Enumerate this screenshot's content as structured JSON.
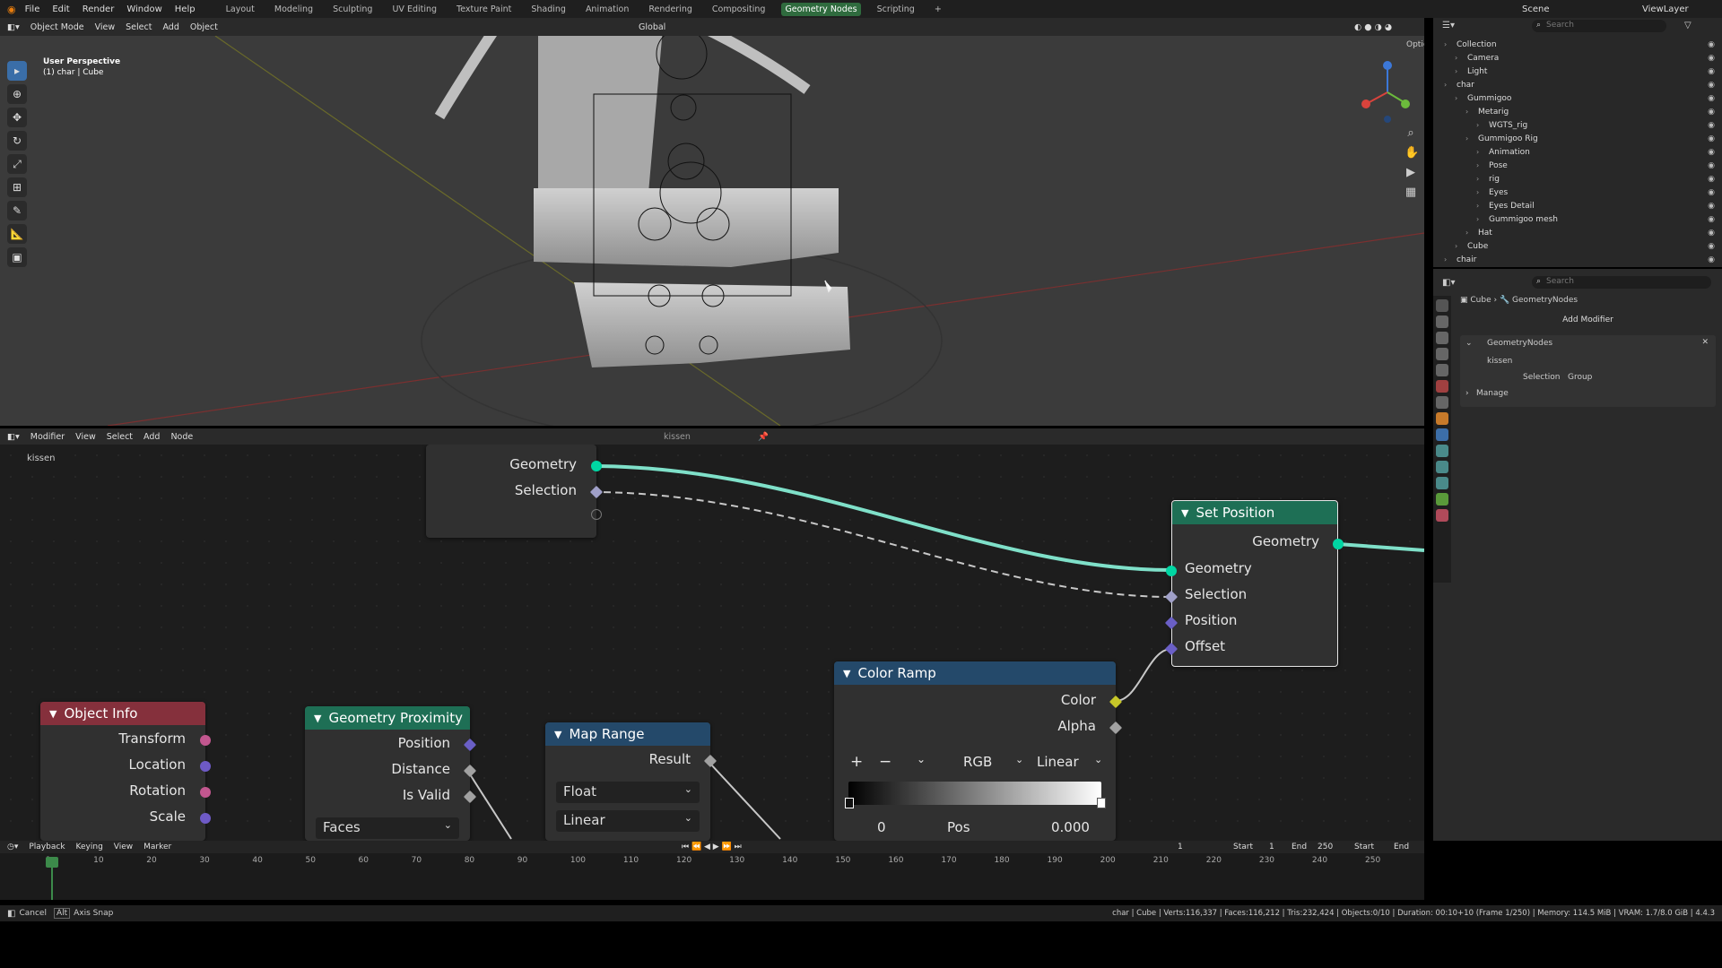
{
  "topbar": {
    "menus": [
      "File",
      "Edit",
      "Render",
      "Window",
      "Help"
    ],
    "workspaces": [
      "Layout",
      "Modeling",
      "Sculpting",
      "UV Editing",
      "Texture Paint",
      "Shading",
      "Animation",
      "Rendering",
      "Compositing",
      "Geometry Nodes",
      "Scripting"
    ],
    "active_workspace": "Geometry Nodes",
    "add_tab": "+",
    "scene": "Scene",
    "view_layer": "ViewLayer"
  },
  "viewport": {
    "mode": "Object Mode",
    "menus": [
      "View",
      "Select",
      "Add",
      "Object"
    ],
    "transform_orientation": "Global",
    "overlay_title": "User Perspective",
    "overlay_subtitle": "(1) char | Cube",
    "options": "Options"
  },
  "node_editor": {
    "editor_type": "Modifier",
    "menus": [
      "View",
      "Select",
      "Add",
      "Node"
    ],
    "node_group": "kissen",
    "breadcrumb": "kissen",
    "group_input": {
      "outputs": [
        "Geometry",
        "Selection"
      ]
    },
    "set_position": {
      "title": "Set Position",
      "output": "Geometry",
      "inputs": [
        "Geometry",
        "Selection",
        "Position",
        "Offset"
      ]
    },
    "color_ramp": {
      "title": "Color Ramp",
      "outputs": [
        "Color",
        "Alpha"
      ],
      "add": "+",
      "remove": "−",
      "color_mode": "RGB",
      "interpolation": "Linear",
      "index": "0",
      "pos_label": "Pos",
      "pos_value": "0.000"
    },
    "object_info": {
      "title": "Object Info",
      "outputs": [
        "Transform",
        "Location",
        "Rotation",
        "Scale"
      ]
    },
    "geometry_proximity": {
      "title": "Geometry Proximity",
      "outputs": [
        "Position",
        "Distance",
        "Is Valid"
      ],
      "target": "Faces"
    },
    "map_range": {
      "title": "Map Range",
      "output": "Result",
      "data_type": "Float",
      "interpolation": "Linear"
    }
  },
  "timeline": {
    "menus": [
      "Playback",
      "Keying",
      "View",
      "Marker"
    ],
    "current_frame": "1",
    "start_label": "Start",
    "start": "1",
    "end_label": "End",
    "end": "250",
    "start2": "Start",
    "end2": "End",
    "ticks": [
      "1",
      "10",
      "20",
      "30",
      "40",
      "50",
      "60",
      "70",
      "80",
      "90",
      "100",
      "110",
      "120",
      "130",
      "140",
      "150",
      "160",
      "170",
      "180",
      "190",
      "200",
      "210",
      "220",
      "230",
      "240",
      "250"
    ]
  },
  "statusbar": {
    "left1": "Cancel",
    "key": "Alt",
    "left2": "Axis Snap",
    "right": "char | Cube | Verts:116,337 | Faces:116,212 | Tris:232,424 | Objects:0/10 | Duration: 00:10+10 (Frame 1/250) | Memory: 114.5 MiB | VRAM: 1.7/8.0 GiB | 4.4.3"
  },
  "outliner": {
    "search_placeholder": "Search",
    "rows": [
      {
        "label": "Collection",
        "indent": 1
      },
      {
        "label": "Camera",
        "indent": 2
      },
      {
        "label": "Light",
        "indent": 2
      },
      {
        "label": "char",
        "indent": 1
      },
      {
        "label": "Gummigoo",
        "indent": 2
      },
      {
        "label": "Metarig",
        "indent": 3
      },
      {
        "label": "WGTS_rig",
        "indent": 4
      },
      {
        "label": "Gummigoo Rig",
        "indent": 3
      },
      {
        "label": "Animation",
        "indent": 4
      },
      {
        "label": "Pose",
        "indent": 4
      },
      {
        "label": "rig",
        "indent": 4
      },
      {
        "label": "Eyes",
        "indent": 4
      },
      {
        "label": "Eyes Detail",
        "indent": 4
      },
      {
        "label": "Gummigoo mesh",
        "indent": 4
      },
      {
        "label": "Hat",
        "indent": 3
      },
      {
        "label": "Cube",
        "indent": 2
      },
      {
        "label": "chair",
        "indent": 1
      }
    ]
  },
  "properties": {
    "search_placeholder": "Search",
    "breadcrumb_obj": "Cube",
    "breadcrumb_mod": "GeometryNodes",
    "add_modifier": "Add Modifier",
    "modifier_name": "GeometryNodes",
    "node_group": "kissen",
    "selection_label": "Selection",
    "group_label": "Group",
    "manage": "Manage"
  }
}
